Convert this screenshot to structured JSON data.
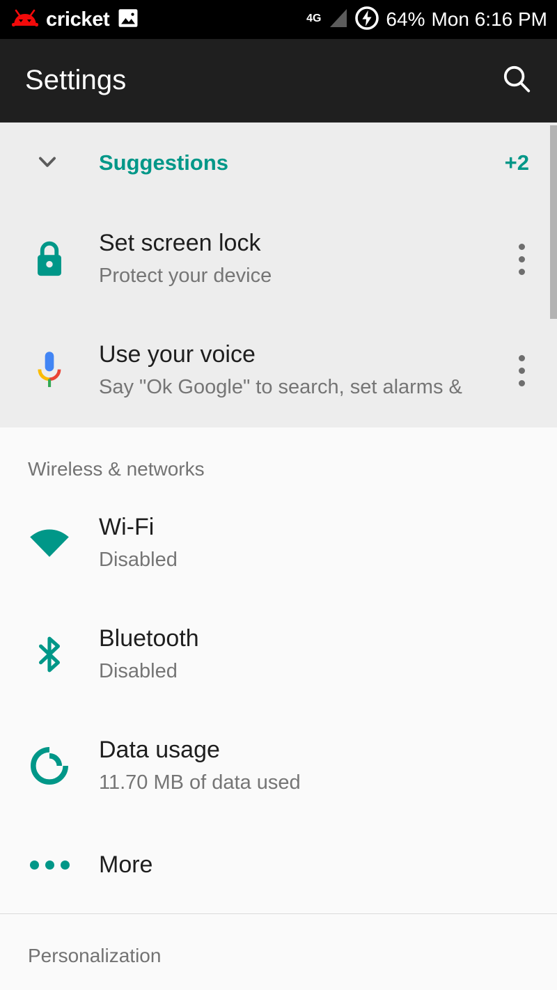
{
  "status_bar": {
    "carrier": "cricket",
    "carrier_icon": "android-mascot-icon",
    "photo_icon": "image-icon",
    "network_type": "4G",
    "signal_icon": "signal-bars-icon",
    "battery_icon": "battery-charging-icon",
    "battery_percent": "64%",
    "day_time": "Mon 6:16 PM",
    "status_summary": "64% Mon 6:16 PM"
  },
  "app_bar": {
    "title": "Settings",
    "search_icon": "search-icon"
  },
  "suggestions": {
    "header_label": "Suggestions",
    "count_badge": "+2",
    "expand_icon": "chevron-down-icon",
    "items": [
      {
        "icon": "lock-icon",
        "title": "Set screen lock",
        "subtitle": "Protect your device",
        "overflow_icon": "more-vert-icon"
      },
      {
        "icon": "google-mic-icon",
        "title": "Use your voice",
        "subtitle": "Say \"Ok Google\" to search, set alarms & ",
        "overflow_icon": "more-vert-icon"
      }
    ]
  },
  "sections": [
    {
      "header": "Wireless & networks",
      "items": [
        {
          "icon": "wifi-icon",
          "title": "Wi-Fi",
          "subtitle": "Disabled"
        },
        {
          "icon": "bluetooth-icon",
          "title": "Bluetooth",
          "subtitle": "Disabled"
        },
        {
          "icon": "data-usage-icon",
          "title": "Data usage",
          "subtitle": "11.70 MB of data used"
        },
        {
          "icon": "more-horiz-icon",
          "title": "More",
          "subtitle": ""
        }
      ]
    },
    {
      "header": "Personalization",
      "items": []
    }
  ],
  "colors": {
    "accent_teal": "#009788",
    "status_bar_bg": "#000000",
    "app_bar_bg": "#1f1f1f",
    "suggestion_card_bg": "#ededed",
    "list_bg": "#fafafa",
    "primary_text": "#1e1e1e",
    "secondary_text": "#757575"
  }
}
